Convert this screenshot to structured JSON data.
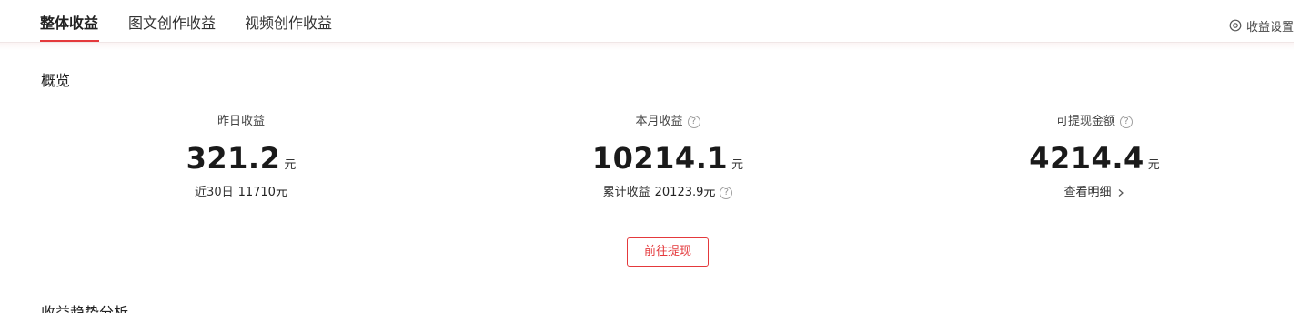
{
  "tabs": [
    {
      "label": "整体收益",
      "active": true
    },
    {
      "label": "图文创作收益",
      "active": false
    },
    {
      "label": "视频创作收益",
      "active": false
    }
  ],
  "settings": {
    "label": "收益设置",
    "icon": "settings-circle-icon"
  },
  "overview": {
    "title": "概览",
    "stats": [
      {
        "label": "昨日收益",
        "value": "321.2",
        "unit": "元",
        "sub_label": "近30日",
        "sub_value": "11710元"
      },
      {
        "label": "本月收益",
        "value": "10214.1",
        "unit": "元",
        "sub_label": "累计收益",
        "sub_value": "20123.9元"
      },
      {
        "label": "可提现金额",
        "value": "4214.4",
        "unit": "元",
        "sub_link": "查看明细"
      }
    ],
    "withdraw_button": "前往提现"
  },
  "trend": {
    "title": "收益趋势分析"
  },
  "colors": {
    "accent": "#e4393c",
    "text": "#222222",
    "muted": "#909090"
  }
}
